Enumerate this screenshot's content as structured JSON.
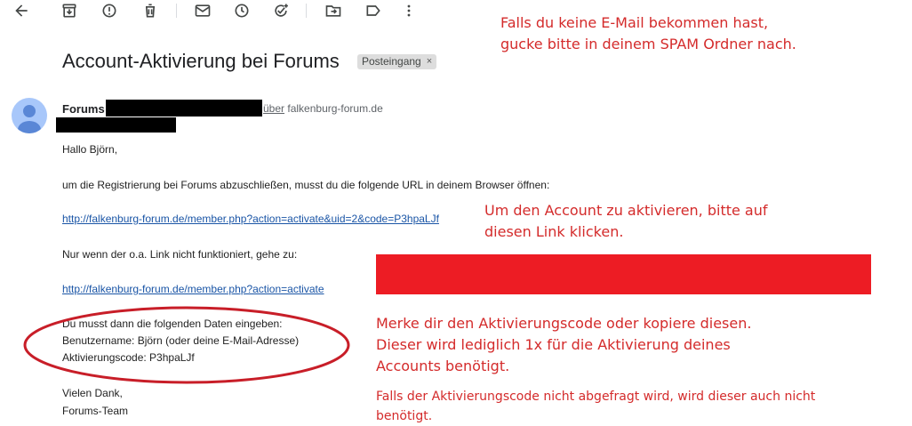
{
  "toolbar": {
    "icons": [
      "back-arrow-icon",
      "archive-icon",
      "report-spam-icon",
      "delete-icon",
      "mark-unread-icon",
      "snooze-icon",
      "add-task-icon",
      "move-to-icon",
      "label-icon",
      "more-options-icon"
    ]
  },
  "email": {
    "subject": "Account-Aktivierung bei Forums",
    "label": "Posteingang",
    "label_close": "×",
    "sender_name": "Forums",
    "via_word": "über",
    "via_domain": "falkenburg-forum.de",
    "greeting": "Hallo Björn,",
    "para1": "um die Registrierung bei Forums abzuschließen, musst du die folgende URL in deinem Browser öffnen:",
    "link1": "http://falkenburg-forum.de/member.php?action=activate&uid=2&code=P3hpaLJf",
    "para2": "Nur wenn der o.a. Link nicht funktioniert, gehe zu:",
    "link2": "http://falkenburg-forum.de/member.php?action=activate",
    "data_line1": "Du musst dann die folgenden Daten eingeben:",
    "data_line2": "Benutzername: Björn (oder deine E-Mail-Adresse)",
    "data_line3": "Aktivierungscode: P3hpaLJf",
    "thanks": "Vielen Dank,",
    "team": "Forums-Team"
  },
  "annotations": {
    "spam_line1": "Falls du keine E-Mail bekommen hast,",
    "spam_line2": "gucke bitte in deinem SPAM Ordner nach.",
    "link_line1": "Um den Account zu aktivieren, bitte auf",
    "link_line2": "diesen Link klicken.",
    "code_line1": "Merke dir den Aktivierungscode oder kopiere diesen.",
    "code_line2": "Dieser wird lediglich 1x für die Aktivierung deines",
    "code_line3": "Accounts benötigt.",
    "note_line1": "Falls der Aktivierungscode nicht abgefragt wird, wird dieser auch nicht",
    "note_line2": "benötigt."
  },
  "colors": {
    "annotation_red": "#d42b2b",
    "redaction_red": "#ed1c24",
    "link_blue": "#1a55a6",
    "avatar_blue": "#a8c7fa"
  }
}
